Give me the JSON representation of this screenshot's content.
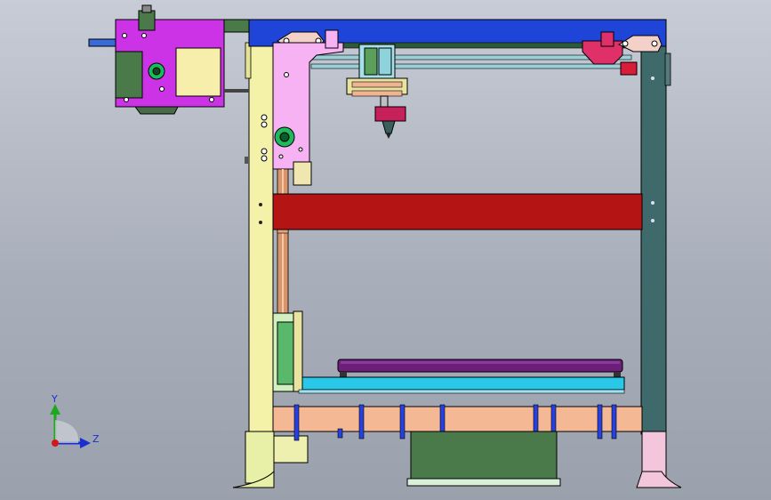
{
  "viewport": {
    "background_top": "#c7ccd6",
    "background_bottom": "#9aa1ac"
  },
  "triad": {
    "y_label": "Y",
    "z_label": "Z",
    "y_color": "#1fa81f",
    "z_color": "#1a2fd0",
    "x_color": "#d01a1a"
  },
  "colors": {
    "top_beam": "#1f44d8",
    "left_post": "#f3f2a8",
    "right_post": "#3f6a6c",
    "red_beam": "#b51414",
    "carriage_pink": "#f7b2f4",
    "extruder_purple": "#cc33e6",
    "build_plate": "#6b1f78",
    "bed_cyan": "#29c8e8",
    "base_beam": "#f5b894",
    "clips": "#2740e0",
    "motor_box": "#4b7a4a",
    "lead_screw": "#d8956a"
  }
}
